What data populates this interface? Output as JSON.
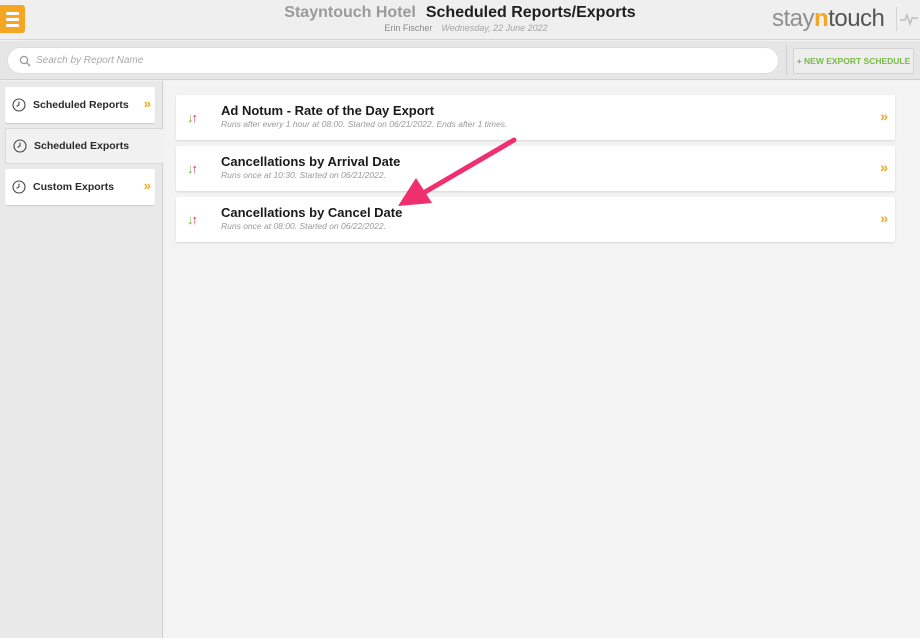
{
  "header": {
    "hotel_name": "Stayntouch Hotel",
    "page_title": "Scheduled Reports/Exports",
    "user_name": "Erin Fischer",
    "date": "Wednesday, 22 June 2022",
    "brand": {
      "part1": "stay",
      "part2": "n",
      "part3": "touch"
    },
    "menu_icon": "hamburger-icon"
  },
  "search": {
    "placeholder": "Search by Report Name",
    "value": ""
  },
  "toolbar": {
    "new_export_label": "+ NEW EXPORT SCHEDULE"
  },
  "sidebar": {
    "items": [
      {
        "label": "Scheduled Reports",
        "icon": "clock-icon",
        "active": false
      },
      {
        "label": "Scheduled Exports",
        "icon": "clock-icon",
        "active": true
      },
      {
        "label": "Custom Exports",
        "icon": "clock-icon",
        "active": false
      }
    ],
    "chevron": "»"
  },
  "reports": [
    {
      "title": "Ad Notum - Rate of the Day Export",
      "subtitle": "Runs after every 1 hour at 08:00. Started on 06/21/2022. Ends after 1 times."
    },
    {
      "title": "Cancellations by Arrival Date",
      "subtitle": "Runs once at 10:30. Started on 06/21/2022."
    },
    {
      "title": "Cancellations by Cancel Date",
      "subtitle": "Runs once at 08:00. Started on 06/22/2022."
    }
  ],
  "glyphs": {
    "down": "↓",
    "up": "↑",
    "chevron": "»"
  },
  "colors": {
    "accent": "#f5a623",
    "green": "#6cb33e",
    "red": "#e0393e",
    "annotation": "#f0306e"
  }
}
